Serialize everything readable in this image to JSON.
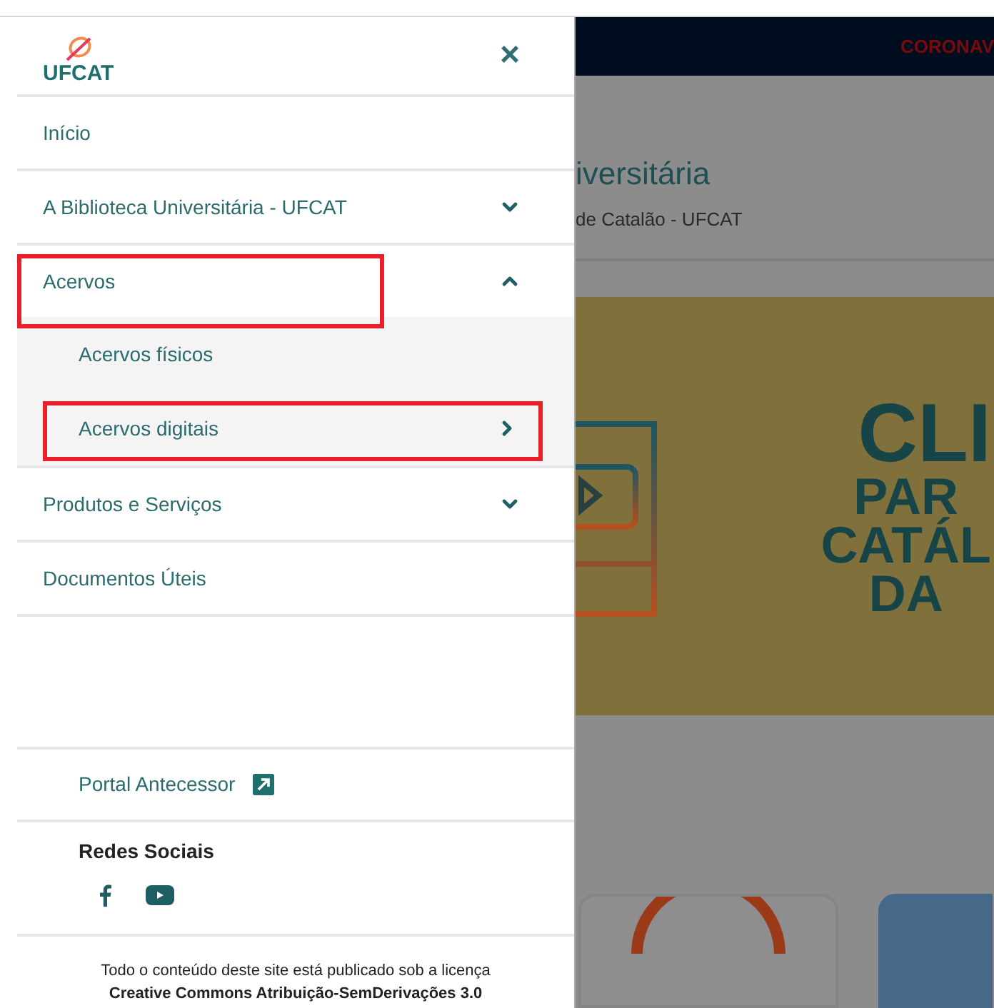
{
  "sidebar": {
    "logo": "UFCAT",
    "close": "×",
    "items": [
      {
        "label": "Início",
        "kind": "link",
        "highlighted": false
      },
      {
        "label": "A Biblioteca Universitária - UFCAT",
        "kind": "group",
        "expanded": false,
        "highlighted": false
      },
      {
        "label": "Acervos",
        "kind": "group",
        "expanded": true,
        "highlighted": true,
        "children": [
          {
            "label": "Acervos físicos",
            "kind": "link",
            "highlighted": false
          },
          {
            "label": "Acervos digitais",
            "kind": "submenu",
            "highlighted": true
          }
        ]
      },
      {
        "label": "Produtos e Serviços",
        "kind": "group",
        "expanded": false,
        "highlighted": false
      },
      {
        "label": "Documentos Úteis",
        "kind": "link",
        "highlighted": false
      }
    ],
    "portal_link": "Portal Antecessor",
    "social_title": "Redes Sociais",
    "license_text": "Todo o conteúdo deste site está publicado sob a licença",
    "license_name": "Creative Commons Atribuição-SemDerivações 3.0"
  },
  "page": {
    "top_bar_text": "CORONAV",
    "title": "iversitária",
    "subtitle": "de Catalão - UFCAT",
    "banner_lines": [
      "CLI",
      "PAR",
      "CATÁL",
      "DA"
    ]
  }
}
